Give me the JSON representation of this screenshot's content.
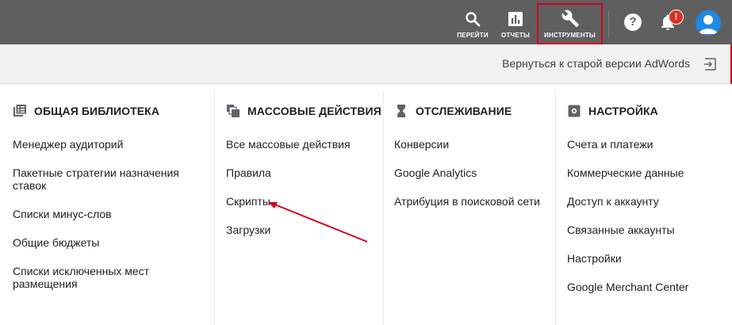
{
  "topbar": {
    "go_label": "ПЕРЕЙТИ",
    "reports_label": "ОТЧЕТЫ",
    "tools_label": "ИНСТРУМЕНТЫ",
    "help_glyph": "?",
    "notification_badge": "!",
    "highlight_color": "#d0021b"
  },
  "subbar": {
    "back_link": "Вернуться к старой версии AdWords"
  },
  "columns": [
    {
      "title": "ОБЩАЯ БИБЛИОТЕКА",
      "icon": "library-icon",
      "items": [
        "Менеджер аудиторий",
        "Пакетные стратегии назначения ставок",
        "Списки минус-слов",
        "Общие бюджеты",
        "Списки исключенных мест размещения"
      ]
    },
    {
      "title": "МАССОВЫЕ ДЕЙСТВИЯ",
      "icon": "bulk-actions-icon",
      "items": [
        "Все массовые действия",
        "Правила",
        "Скрипты",
        "Загрузки"
      ]
    },
    {
      "title": "ОТСЛЕЖИВАНИЕ",
      "icon": "hourglass-icon",
      "items": [
        "Конверсии",
        "Google Analytics",
        "Атрибуция в поисковой сети"
      ]
    },
    {
      "title": "НАСТРОЙКА",
      "icon": "settings-gear-icon",
      "items": [
        "Счета и платежи",
        "Коммерческие данные",
        "Доступ к аккаунту",
        "Связанные аккаунты",
        "Настройки",
        "Google Merchant Center"
      ]
    }
  ],
  "colors": {
    "topbar_bg": "#5f5f5f",
    "subbar_bg": "#f1f1f1",
    "annotation": "#d0021b",
    "avatar": "#1e88e5",
    "badge": "#d93025"
  }
}
